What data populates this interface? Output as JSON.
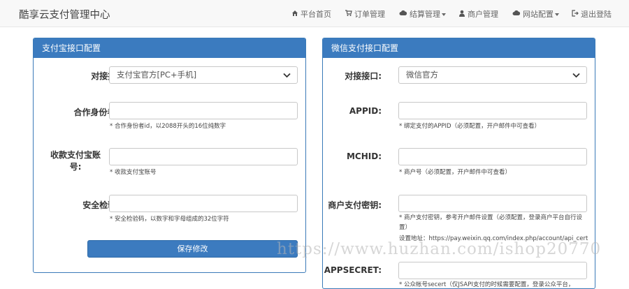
{
  "navbar": {
    "brand": "酷享云支付管理中心",
    "items": [
      {
        "label": "平台首页",
        "icon": "home-icon"
      },
      {
        "label": "订单管理",
        "icon": "cart-icon"
      },
      {
        "label": "结算管理",
        "icon": "cloud-icon",
        "dropdown": true
      },
      {
        "label": "商户管理",
        "icon": "user-icon"
      },
      {
        "label": "网站配置",
        "icon": "cloud-icon",
        "dropdown": true
      },
      {
        "label": "退出登陆",
        "icon": "logout-icon"
      }
    ]
  },
  "alipay": {
    "title": "支付宝接口配置",
    "interface_label": "对接接口:",
    "interface_value": "支付宝官方[PC+手机]",
    "partner_label": "合作身份者id:",
    "partner_value": "",
    "partner_help": "* 合作身份者id，以2088开头的16位纯数字",
    "account_label": "收款支付宝账号:",
    "account_value": "",
    "account_help": "* 收款支付宝账号",
    "key_label": "安全检验码:",
    "key_value": "",
    "key_help": "* 安全检验码，以数字和字母组成的32位字符",
    "save_label": "保存修改"
  },
  "wechat": {
    "title": "微信支付接口配置",
    "interface_label": "对接接口:",
    "interface_value": "微信官方",
    "appid_label": "APPID:",
    "appid_value": "",
    "appid_help": "* 绑定支付的APPID（必须配置，开户邮件中可查看）",
    "mchid_label": "MCHID:",
    "mchid_value": "",
    "mchid_help": "* 商户号（必须配置，开户邮件中可查看）",
    "key_label": "商户支付密钥:",
    "key_value": "",
    "key_help": "* 商户支付密钥，参考开户邮件设置（必须配置，登录商户平台自行设置）",
    "key_help_url": "设置地址：https://pay.weixin.qq.com/index.php/account/api_cert",
    "secret_label": "APPSECRET:",
    "secret_value": "",
    "secret_help": "* 公众帐号secert（仅JSAPI支付的时候需要配置，登录公众平台，"
  },
  "watermark": "https://www.huzhan.com/ishop20770",
  "colors": {
    "panel_header": "#3b7bbf",
    "button": "#3c7bbf",
    "navbar": "#f8f8f8"
  }
}
